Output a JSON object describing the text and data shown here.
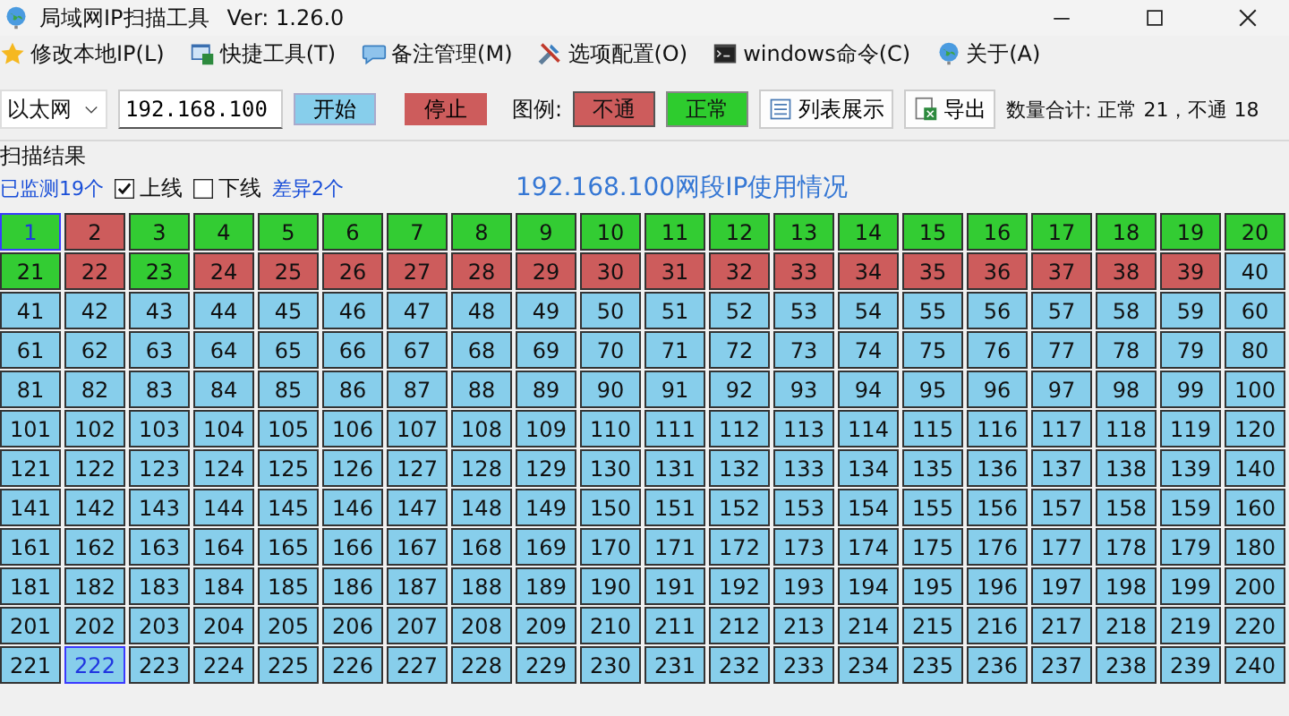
{
  "window": {
    "title": "局域网IP扫描工具",
    "version": "Ver: 1.26.0"
  },
  "menu": [
    {
      "label": "修改本地IP(L)"
    },
    {
      "label": "快捷工具(T)"
    },
    {
      "label": "备注管理(M)"
    },
    {
      "label": "选项配置(O)"
    },
    {
      "label": "windows命令(C)"
    },
    {
      "label": "关于(A)"
    }
  ],
  "toolbar": {
    "adapter": "以太网",
    "ip_field": {
      "value": "192.168.100"
    },
    "start_button": "开始",
    "stop_button": "停止",
    "legend_label": "图例:",
    "legend": [
      {
        "label": "不通",
        "kind": "down"
      },
      {
        "label": "正常",
        "kind": "up"
      }
    ],
    "list_button": "列表展示",
    "export_button": "导出",
    "summary": "数量合计: 正常 21，不通 18"
  },
  "results": {
    "heading": "扫描结果",
    "monitored": "已监测19个",
    "online": {
      "label": "上线",
      "checked": true
    },
    "offline": {
      "label": "下线",
      "checked": false
    },
    "diff": "差异2个",
    "title": "192.168.100网段IP使用情况"
  },
  "grid": {
    "cells": [
      {
        "label": "1",
        "kind": "up",
        "selected": true
      },
      {
        "label": "2",
        "kind": "down",
        "selected": false
      },
      {
        "label": "3",
        "kind": "up",
        "selected": false
      },
      {
        "label": "4",
        "kind": "up",
        "selected": false
      },
      {
        "label": "5",
        "kind": "up",
        "selected": false
      },
      {
        "label": "6",
        "kind": "up",
        "selected": false
      },
      {
        "label": "7",
        "kind": "up",
        "selected": false
      },
      {
        "label": "8",
        "kind": "up",
        "selected": false
      },
      {
        "label": "9",
        "kind": "up",
        "selected": false
      },
      {
        "label": "10",
        "kind": "up",
        "selected": false
      },
      {
        "label": "11",
        "kind": "up",
        "selected": false
      },
      {
        "label": "12",
        "kind": "up",
        "selected": false
      },
      {
        "label": "13",
        "kind": "up",
        "selected": false
      },
      {
        "label": "14",
        "kind": "up",
        "selected": false
      },
      {
        "label": "15",
        "kind": "up",
        "selected": false
      },
      {
        "label": "16",
        "kind": "up",
        "selected": false
      },
      {
        "label": "17",
        "kind": "up",
        "selected": false
      },
      {
        "label": "18",
        "kind": "up",
        "selected": false
      },
      {
        "label": "19",
        "kind": "up",
        "selected": false
      },
      {
        "label": "20",
        "kind": "up",
        "selected": false
      },
      {
        "label": "21",
        "kind": "up",
        "selected": false
      },
      {
        "label": "22",
        "kind": "down",
        "selected": false
      },
      {
        "label": "23",
        "kind": "up",
        "selected": false
      },
      {
        "label": "24",
        "kind": "down",
        "selected": false
      },
      {
        "label": "25",
        "kind": "down",
        "selected": false
      },
      {
        "label": "26",
        "kind": "down",
        "selected": false
      },
      {
        "label": "27",
        "kind": "down",
        "selected": false
      },
      {
        "label": "28",
        "kind": "down",
        "selected": false
      },
      {
        "label": "29",
        "kind": "down",
        "selected": false
      },
      {
        "label": "30",
        "kind": "down",
        "selected": false
      },
      {
        "label": "31",
        "kind": "down",
        "selected": false
      },
      {
        "label": "32",
        "kind": "down",
        "selected": false
      },
      {
        "label": "33",
        "kind": "down",
        "selected": false
      },
      {
        "label": "34",
        "kind": "down",
        "selected": false
      },
      {
        "label": "35",
        "kind": "down",
        "selected": false
      },
      {
        "label": "36",
        "kind": "down",
        "selected": false
      },
      {
        "label": "37",
        "kind": "down",
        "selected": false
      },
      {
        "label": "38",
        "kind": "down",
        "selected": false
      },
      {
        "label": "39",
        "kind": "down",
        "selected": false
      },
      {
        "label": "40",
        "kind": "idle",
        "selected": false
      },
      {
        "label": "41",
        "kind": "idle",
        "selected": false
      },
      {
        "label": "42",
        "kind": "idle",
        "selected": false
      },
      {
        "label": "43",
        "kind": "idle",
        "selected": false
      },
      {
        "label": "44",
        "kind": "idle",
        "selected": false
      },
      {
        "label": "45",
        "kind": "idle",
        "selected": false
      },
      {
        "label": "46",
        "kind": "idle",
        "selected": false
      },
      {
        "label": "47",
        "kind": "idle",
        "selected": false
      },
      {
        "label": "48",
        "kind": "idle",
        "selected": false
      },
      {
        "label": "49",
        "kind": "idle",
        "selected": false
      },
      {
        "label": "50",
        "kind": "idle",
        "selected": false
      },
      {
        "label": "51",
        "kind": "idle",
        "selected": false
      },
      {
        "label": "52",
        "kind": "idle",
        "selected": false
      },
      {
        "label": "53",
        "kind": "idle",
        "selected": false
      },
      {
        "label": "54",
        "kind": "idle",
        "selected": false
      },
      {
        "label": "55",
        "kind": "idle",
        "selected": false
      },
      {
        "label": "56",
        "kind": "idle",
        "selected": false
      },
      {
        "label": "57",
        "kind": "idle",
        "selected": false
      },
      {
        "label": "58",
        "kind": "idle",
        "selected": false
      },
      {
        "label": "59",
        "kind": "idle",
        "selected": false
      },
      {
        "label": "60",
        "kind": "idle",
        "selected": false
      },
      {
        "label": "61",
        "kind": "idle",
        "selected": false
      },
      {
        "label": "62",
        "kind": "idle",
        "selected": false
      },
      {
        "label": "63",
        "kind": "idle",
        "selected": false
      },
      {
        "label": "64",
        "kind": "idle",
        "selected": false
      },
      {
        "label": "65",
        "kind": "idle",
        "selected": false
      },
      {
        "label": "66",
        "kind": "idle",
        "selected": false
      },
      {
        "label": "67",
        "kind": "idle",
        "selected": false
      },
      {
        "label": "68",
        "kind": "idle",
        "selected": false
      },
      {
        "label": "69",
        "kind": "idle",
        "selected": false
      },
      {
        "label": "70",
        "kind": "idle",
        "selected": false
      },
      {
        "label": "71",
        "kind": "idle",
        "selected": false
      },
      {
        "label": "72",
        "kind": "idle",
        "selected": false
      },
      {
        "label": "73",
        "kind": "idle",
        "selected": false
      },
      {
        "label": "74",
        "kind": "idle",
        "selected": false
      },
      {
        "label": "75",
        "kind": "idle",
        "selected": false
      },
      {
        "label": "76",
        "kind": "idle",
        "selected": false
      },
      {
        "label": "77",
        "kind": "idle",
        "selected": false
      },
      {
        "label": "78",
        "kind": "idle",
        "selected": false
      },
      {
        "label": "79",
        "kind": "idle",
        "selected": false
      },
      {
        "label": "80",
        "kind": "idle",
        "selected": false
      },
      {
        "label": "81",
        "kind": "idle",
        "selected": false
      },
      {
        "label": "82",
        "kind": "idle",
        "selected": false
      },
      {
        "label": "83",
        "kind": "idle",
        "selected": false
      },
      {
        "label": "84",
        "kind": "idle",
        "selected": false
      },
      {
        "label": "85",
        "kind": "idle",
        "selected": false
      },
      {
        "label": "86",
        "kind": "idle",
        "selected": false
      },
      {
        "label": "87",
        "kind": "idle",
        "selected": false
      },
      {
        "label": "88",
        "kind": "idle",
        "selected": false
      },
      {
        "label": "89",
        "kind": "idle",
        "selected": false
      },
      {
        "label": "90",
        "kind": "idle",
        "selected": false
      },
      {
        "label": "91",
        "kind": "idle",
        "selected": false
      },
      {
        "label": "92",
        "kind": "idle",
        "selected": false
      },
      {
        "label": "93",
        "kind": "idle",
        "selected": false
      },
      {
        "label": "94",
        "kind": "idle",
        "selected": false
      },
      {
        "label": "95",
        "kind": "idle",
        "selected": false
      },
      {
        "label": "96",
        "kind": "idle",
        "selected": false
      },
      {
        "label": "97",
        "kind": "idle",
        "selected": false
      },
      {
        "label": "98",
        "kind": "idle",
        "selected": false
      },
      {
        "label": "99",
        "kind": "idle",
        "selected": false
      },
      {
        "label": "100",
        "kind": "idle",
        "selected": false
      },
      {
        "label": "101",
        "kind": "idle",
        "selected": false
      },
      {
        "label": "102",
        "kind": "idle",
        "selected": false
      },
      {
        "label": "103",
        "kind": "idle",
        "selected": false
      },
      {
        "label": "104",
        "kind": "idle",
        "selected": false
      },
      {
        "label": "105",
        "kind": "idle",
        "selected": false
      },
      {
        "label": "106",
        "kind": "idle",
        "selected": false
      },
      {
        "label": "107",
        "kind": "idle",
        "selected": false
      },
      {
        "label": "108",
        "kind": "idle",
        "selected": false
      },
      {
        "label": "109",
        "kind": "idle",
        "selected": false
      },
      {
        "label": "110",
        "kind": "idle",
        "selected": false
      },
      {
        "label": "111",
        "kind": "idle",
        "selected": false
      },
      {
        "label": "112",
        "kind": "idle",
        "selected": false
      },
      {
        "label": "113",
        "kind": "idle",
        "selected": false
      },
      {
        "label": "114",
        "kind": "idle",
        "selected": false
      },
      {
        "label": "115",
        "kind": "idle",
        "selected": false
      },
      {
        "label": "116",
        "kind": "idle",
        "selected": false
      },
      {
        "label": "117",
        "kind": "idle",
        "selected": false
      },
      {
        "label": "118",
        "kind": "idle",
        "selected": false
      },
      {
        "label": "119",
        "kind": "idle",
        "selected": false
      },
      {
        "label": "120",
        "kind": "idle",
        "selected": false
      },
      {
        "label": "121",
        "kind": "idle",
        "selected": false
      },
      {
        "label": "122",
        "kind": "idle",
        "selected": false
      },
      {
        "label": "123",
        "kind": "idle",
        "selected": false
      },
      {
        "label": "124",
        "kind": "idle",
        "selected": false
      },
      {
        "label": "125",
        "kind": "idle",
        "selected": false
      },
      {
        "label": "126",
        "kind": "idle",
        "selected": false
      },
      {
        "label": "127",
        "kind": "idle",
        "selected": false
      },
      {
        "label": "128",
        "kind": "idle",
        "selected": false
      },
      {
        "label": "129",
        "kind": "idle",
        "selected": false
      },
      {
        "label": "130",
        "kind": "idle",
        "selected": false
      },
      {
        "label": "131",
        "kind": "idle",
        "selected": false
      },
      {
        "label": "132",
        "kind": "idle",
        "selected": false
      },
      {
        "label": "133",
        "kind": "idle",
        "selected": false
      },
      {
        "label": "134",
        "kind": "idle",
        "selected": false
      },
      {
        "label": "135",
        "kind": "idle",
        "selected": false
      },
      {
        "label": "136",
        "kind": "idle",
        "selected": false
      },
      {
        "label": "137",
        "kind": "idle",
        "selected": false
      },
      {
        "label": "138",
        "kind": "idle",
        "selected": false
      },
      {
        "label": "139",
        "kind": "idle",
        "selected": false
      },
      {
        "label": "140",
        "kind": "idle",
        "selected": false
      },
      {
        "label": "141",
        "kind": "idle",
        "selected": false
      },
      {
        "label": "142",
        "kind": "idle",
        "selected": false
      },
      {
        "label": "143",
        "kind": "idle",
        "selected": false
      },
      {
        "label": "144",
        "kind": "idle",
        "selected": false
      },
      {
        "label": "145",
        "kind": "idle",
        "selected": false
      },
      {
        "label": "146",
        "kind": "idle",
        "selected": false
      },
      {
        "label": "147",
        "kind": "idle",
        "selected": false
      },
      {
        "label": "148",
        "kind": "idle",
        "selected": false
      },
      {
        "label": "149",
        "kind": "idle",
        "selected": false
      },
      {
        "label": "150",
        "kind": "idle",
        "selected": false
      },
      {
        "label": "151",
        "kind": "idle",
        "selected": false
      },
      {
        "label": "152",
        "kind": "idle",
        "selected": false
      },
      {
        "label": "153",
        "kind": "idle",
        "selected": false
      },
      {
        "label": "154",
        "kind": "idle",
        "selected": false
      },
      {
        "label": "155",
        "kind": "idle",
        "selected": false
      },
      {
        "label": "156",
        "kind": "idle",
        "selected": false
      },
      {
        "label": "157",
        "kind": "idle",
        "selected": false
      },
      {
        "label": "158",
        "kind": "idle",
        "selected": false
      },
      {
        "label": "159",
        "kind": "idle",
        "selected": false
      },
      {
        "label": "160",
        "kind": "idle",
        "selected": false
      },
      {
        "label": "161",
        "kind": "idle",
        "selected": false
      },
      {
        "label": "162",
        "kind": "idle",
        "selected": false
      },
      {
        "label": "163",
        "kind": "idle",
        "selected": false
      },
      {
        "label": "164",
        "kind": "idle",
        "selected": false
      },
      {
        "label": "165",
        "kind": "idle",
        "selected": false
      },
      {
        "label": "166",
        "kind": "idle",
        "selected": false
      },
      {
        "label": "167",
        "kind": "idle",
        "selected": false
      },
      {
        "label": "168",
        "kind": "idle",
        "selected": false
      },
      {
        "label": "169",
        "kind": "idle",
        "selected": false
      },
      {
        "label": "170",
        "kind": "idle",
        "selected": false
      },
      {
        "label": "171",
        "kind": "idle",
        "selected": false
      },
      {
        "label": "172",
        "kind": "idle",
        "selected": false
      },
      {
        "label": "173",
        "kind": "idle",
        "selected": false
      },
      {
        "label": "174",
        "kind": "idle",
        "selected": false
      },
      {
        "label": "175",
        "kind": "idle",
        "selected": false
      },
      {
        "label": "176",
        "kind": "idle",
        "selected": false
      },
      {
        "label": "177",
        "kind": "idle",
        "selected": false
      },
      {
        "label": "178",
        "kind": "idle",
        "selected": false
      },
      {
        "label": "179",
        "kind": "idle",
        "selected": false
      },
      {
        "label": "180",
        "kind": "idle",
        "selected": false
      },
      {
        "label": "181",
        "kind": "idle",
        "selected": false
      },
      {
        "label": "182",
        "kind": "idle",
        "selected": false
      },
      {
        "label": "183",
        "kind": "idle",
        "selected": false
      },
      {
        "label": "184",
        "kind": "idle",
        "selected": false
      },
      {
        "label": "185",
        "kind": "idle",
        "selected": false
      },
      {
        "label": "186",
        "kind": "idle",
        "selected": false
      },
      {
        "label": "187",
        "kind": "idle",
        "selected": false
      },
      {
        "label": "188",
        "kind": "idle",
        "selected": false
      },
      {
        "label": "189",
        "kind": "idle",
        "selected": false
      },
      {
        "label": "190",
        "kind": "idle",
        "selected": false
      },
      {
        "label": "191",
        "kind": "idle",
        "selected": false
      },
      {
        "label": "192",
        "kind": "idle",
        "selected": false
      },
      {
        "label": "193",
        "kind": "idle",
        "selected": false
      },
      {
        "label": "194",
        "kind": "idle",
        "selected": false
      },
      {
        "label": "195",
        "kind": "idle",
        "selected": false
      },
      {
        "label": "196",
        "kind": "idle",
        "selected": false
      },
      {
        "label": "197",
        "kind": "idle",
        "selected": false
      },
      {
        "label": "198",
        "kind": "idle",
        "selected": false
      },
      {
        "label": "199",
        "kind": "idle",
        "selected": false
      },
      {
        "label": "200",
        "kind": "idle",
        "selected": false
      },
      {
        "label": "201",
        "kind": "idle",
        "selected": false
      },
      {
        "label": "202",
        "kind": "idle",
        "selected": false
      },
      {
        "label": "203",
        "kind": "idle",
        "selected": false
      },
      {
        "label": "204",
        "kind": "idle",
        "selected": false
      },
      {
        "label": "205",
        "kind": "idle",
        "selected": false
      },
      {
        "label": "206",
        "kind": "idle",
        "selected": false
      },
      {
        "label": "207",
        "kind": "idle",
        "selected": false
      },
      {
        "label": "208",
        "kind": "idle",
        "selected": false
      },
      {
        "label": "209",
        "kind": "idle",
        "selected": false
      },
      {
        "label": "210",
        "kind": "idle",
        "selected": false
      },
      {
        "label": "211",
        "kind": "idle",
        "selected": false
      },
      {
        "label": "212",
        "kind": "idle",
        "selected": false
      },
      {
        "label": "213",
        "kind": "idle",
        "selected": false
      },
      {
        "label": "214",
        "kind": "idle",
        "selected": false
      },
      {
        "label": "215",
        "kind": "idle",
        "selected": false
      },
      {
        "label": "216",
        "kind": "idle",
        "selected": false
      },
      {
        "label": "217",
        "kind": "idle",
        "selected": false
      },
      {
        "label": "218",
        "kind": "idle",
        "selected": false
      },
      {
        "label": "219",
        "kind": "idle",
        "selected": false
      },
      {
        "label": "220",
        "kind": "idle",
        "selected": false
      },
      {
        "label": "221",
        "kind": "idle",
        "selected": false
      },
      {
        "label": "222",
        "kind": "idle",
        "selected": true
      },
      {
        "label": "223",
        "kind": "idle",
        "selected": false
      },
      {
        "label": "224",
        "kind": "idle",
        "selected": false
      },
      {
        "label": "225",
        "kind": "idle",
        "selected": false
      },
      {
        "label": "226",
        "kind": "idle",
        "selected": false
      },
      {
        "label": "227",
        "kind": "idle",
        "selected": false
      },
      {
        "label": "228",
        "kind": "idle",
        "selected": false
      },
      {
        "label": "229",
        "kind": "idle",
        "selected": false
      },
      {
        "label": "230",
        "kind": "idle",
        "selected": false
      },
      {
        "label": "231",
        "kind": "idle",
        "selected": false
      },
      {
        "label": "232",
        "kind": "idle",
        "selected": false
      },
      {
        "label": "233",
        "kind": "idle",
        "selected": false
      },
      {
        "label": "234",
        "kind": "idle",
        "selected": false
      },
      {
        "label": "235",
        "kind": "idle",
        "selected": false
      },
      {
        "label": "236",
        "kind": "idle",
        "selected": false
      },
      {
        "label": "237",
        "kind": "idle",
        "selected": false
      },
      {
        "label": "238",
        "kind": "idle",
        "selected": false
      },
      {
        "label": "239",
        "kind": "idle",
        "selected": false
      },
      {
        "label": "240",
        "kind": "idle",
        "selected": false
      }
    ]
  }
}
